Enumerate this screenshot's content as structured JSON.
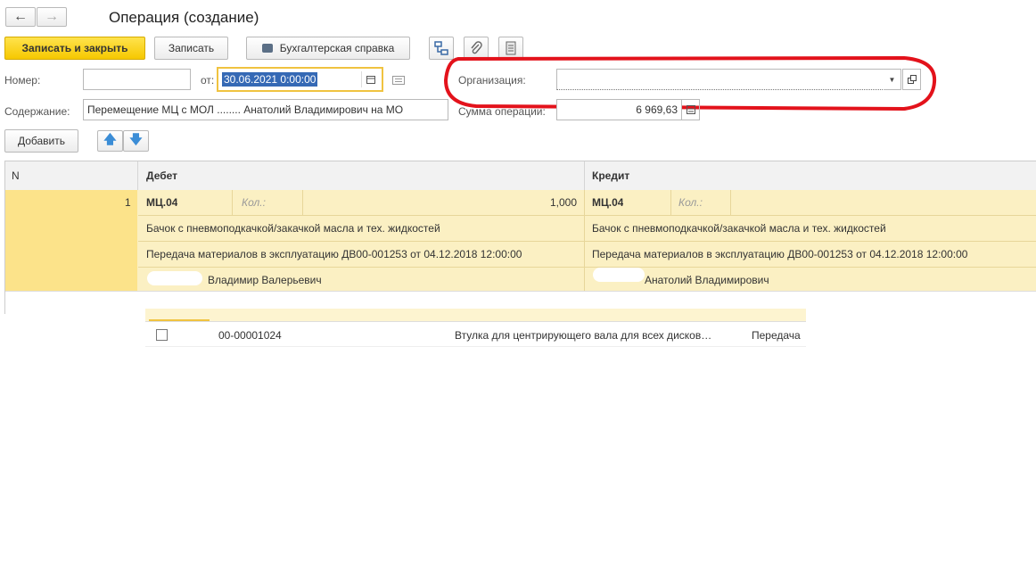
{
  "window": {
    "title": "Операция (создание)"
  },
  "toolbar": {
    "save_close": "Записать и закрыть",
    "save": "Записать",
    "print_label": "Бухгалтерская справка"
  },
  "form": {
    "number_label": "Номер:",
    "number_value": "",
    "date_label": "от:",
    "date_value": "30.06.2021  0:00:00",
    "org_label": "Организация:",
    "org_value": "",
    "content_label": "Содержание:",
    "content_value": "Перемещение МЦ с МОЛ ........ Анатолий Владимирович на МО",
    "sum_label": "Сумма операции:",
    "sum_value": "6 969,63"
  },
  "table_toolbar": {
    "add": "Добавить"
  },
  "table": {
    "headers": {
      "n": "N",
      "debit": "Дебет",
      "credit": "Кредит"
    },
    "rows": [
      {
        "n": "1",
        "debit_account": "МЦ.04",
        "qty_label": "Кол.:",
        "qty_value": "1,000",
        "credit_account": "МЦ.04",
        "credit_qty_label": "Кол.:",
        "debit_sub1": "Бачок с пневмоподкачкой/закачкой масла и тех. жидкостей",
        "debit_sub2": "Передача материалов в эксплуатацию ДВ00-001253 от 04.12.2018 12:00:00",
        "debit_sub3": "Владимир Валерьевич",
        "credit_sub1": "Бачок с пневмоподкачкой/закачкой масла и тех. жидкостей",
        "credit_sub2": "Передача материалов в эксплуатацию ДВ00-001253 от 04.12.2018 12:00:00",
        "credit_sub3": "Анатолий Владимирович"
      }
    ]
  },
  "background_list": {
    "row": {
      "code": "00-00001024",
      "name": "Втулка для центрирующего вала для всех дисков…",
      "doc": "Передача"
    }
  },
  "colors": {
    "highlight": "#e3121b",
    "row_yellow": "#fbf0c3",
    "n_yellow": "#fce38a"
  }
}
